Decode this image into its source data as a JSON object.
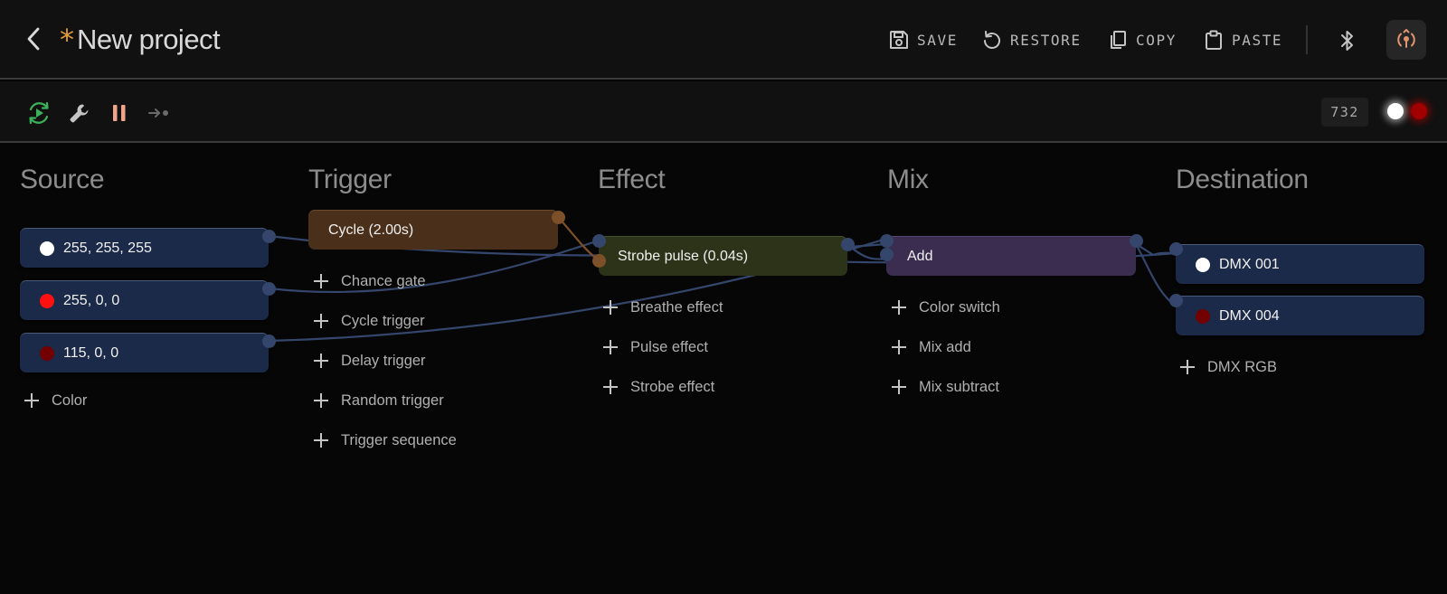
{
  "header": {
    "unsaved_marker": "*",
    "title": "New project",
    "actions": {
      "save": "SAVE",
      "restore": "RESTORE",
      "copy": "COPY",
      "paste": "PASTE"
    },
    "icons": [
      "chevron-left-icon",
      "floppy-disk-icon",
      "restore-icon",
      "copy-icon",
      "clipboard-icon",
      "bluetooth-icon",
      "live-broadcast-icon"
    ]
  },
  "toolbar": {
    "counter": "732",
    "icons": [
      "auto-play-icon",
      "wrench-icon",
      "pause-icon",
      "step-forward-icon"
    ],
    "colors": {
      "play": "#3bb25a",
      "pause": "#f0a58a",
      "step": "#6a6a6a"
    }
  },
  "columns": {
    "source": {
      "title": "Source",
      "nodes": [
        {
          "label": "255, 255, 255",
          "color": "#ffffff"
        },
        {
          "label": "255, 0, 0",
          "color": "#ff1010"
        },
        {
          "label": "115, 0, 0",
          "color": "#730000"
        }
      ],
      "add": [
        "Color"
      ]
    },
    "trigger": {
      "title": "Trigger",
      "nodes": [
        {
          "label": "Cycle (2.00s)"
        }
      ],
      "add": [
        "Chance gate",
        "Cycle trigger",
        "Delay trigger",
        "Random trigger",
        "Trigger sequence"
      ]
    },
    "effect": {
      "title": "Effect",
      "nodes": [
        {
          "label": "Strobe pulse (0.04s)"
        }
      ],
      "add": [
        "Breathe effect",
        "Pulse effect",
        "Strobe effect"
      ]
    },
    "mix": {
      "title": "Mix",
      "nodes": [
        {
          "label": "Add"
        }
      ],
      "add": [
        "Color switch",
        "Mix add",
        "Mix subtract"
      ]
    },
    "destination": {
      "title": "Destination",
      "nodes": [
        {
          "label": "DMX 001",
          "color": "#ffffff"
        },
        {
          "label": "DMX 004",
          "color": "#730000"
        }
      ],
      "add": [
        "DMX RGB"
      ]
    }
  },
  "colors": {
    "wire": "#34466c",
    "wire_trigger": "#7c5028",
    "node_source": "#1c2a49",
    "node_trigger": "#4a2f1a",
    "node_effect": "#2c3318",
    "node_mix": "#3a2d50"
  }
}
